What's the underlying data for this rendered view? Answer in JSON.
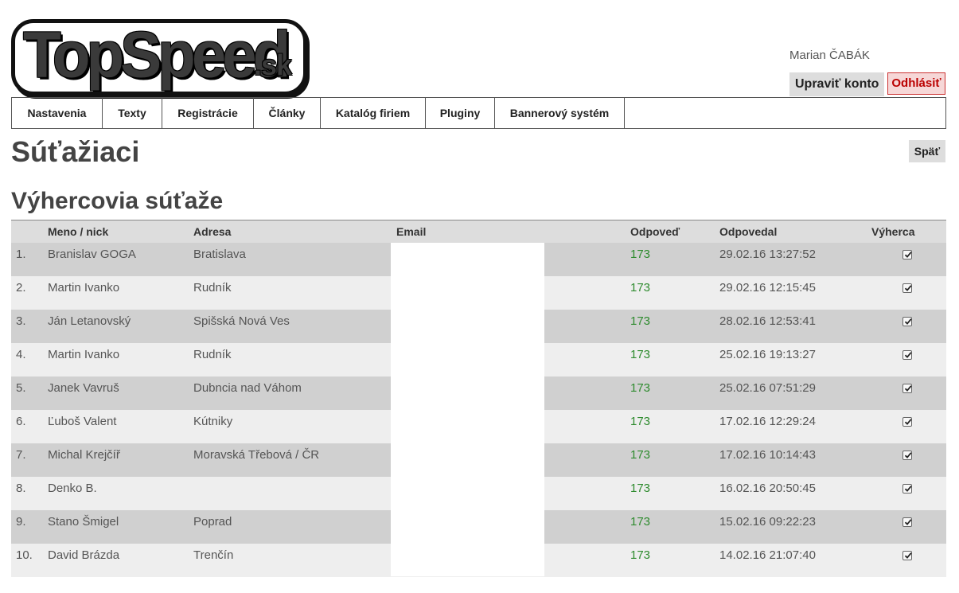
{
  "logo": {
    "main": "TopSpeed",
    "sub": ".sk"
  },
  "user": {
    "name": "Marian ČABÁK",
    "edit_label": "Upraviť konto",
    "logout_label": "Odhlásiť"
  },
  "nav": [
    "Nastavenia",
    "Texty",
    "Registrácie",
    "Články",
    "Katalóg firiem",
    "Pluginy",
    "Bannerový systém"
  ],
  "page": {
    "title": "Súťažiaci",
    "back_label": "Späť",
    "subtitle": "Výhercovia súťaže"
  },
  "table": {
    "headers": {
      "name": "Meno / nick",
      "address": "Adresa",
      "email": "Email",
      "answer": "Odpoveď",
      "answered": "Odpovedal",
      "winner": "Výherca"
    },
    "rows": [
      {
        "num": "1.",
        "name": "Branislav GOGA",
        "address": "Bratislava",
        "answer": "173",
        "answered": "29.02.16 13:27:52",
        "winner": true
      },
      {
        "num": "2.",
        "name": "Martin Ivanko",
        "address": "Rudník",
        "answer": "173",
        "answered": "29.02.16 12:15:45",
        "winner": true
      },
      {
        "num": "3.",
        "name": "Ján Letanovský",
        "address": "Spišská Nová Ves",
        "answer": "173",
        "answered": "28.02.16 12:53:41",
        "winner": true
      },
      {
        "num": "4.",
        "name": "Martin Ivanko",
        "address": "Rudník",
        "answer": "173",
        "answered": "25.02.16 19:13:27",
        "winner": true
      },
      {
        "num": "5.",
        "name": "Janek Vavruš",
        "address": "Dubncia nad Váhom",
        "answer": "173",
        "answered": "25.02.16 07:51:29",
        "winner": true
      },
      {
        "num": "6.",
        "name": "Ľuboš Valent",
        "address": "Kútniky",
        "answer": "173",
        "answered": "17.02.16 12:29:24",
        "winner": true
      },
      {
        "num": "7.",
        "name": "Michal Krejčíř",
        "address": "Moravská Třebová / ČR",
        "answer": "173",
        "answered": "17.02.16 10:14:43",
        "winner": true
      },
      {
        "num": "8.",
        "name": "Denko B.",
        "address": "",
        "answer": "173",
        "answered": "16.02.16 20:50:45",
        "winner": true
      },
      {
        "num": "9.",
        "name": "Stano Šmigel",
        "address": "Poprad",
        "answer": "173",
        "answered": "15.02.16 09:22:23",
        "winner": true
      },
      {
        "num": "10.",
        "name": "David Brázda",
        "address": "Trenčín",
        "answer": "173",
        "answered": "14.02.16 21:07:40",
        "winner": true
      }
    ]
  },
  "colors": {
    "answer": "#2e8b2e",
    "logout": "#b00000",
    "row_odd": "#d0d0d0",
    "row_even": "#eeeeee"
  }
}
